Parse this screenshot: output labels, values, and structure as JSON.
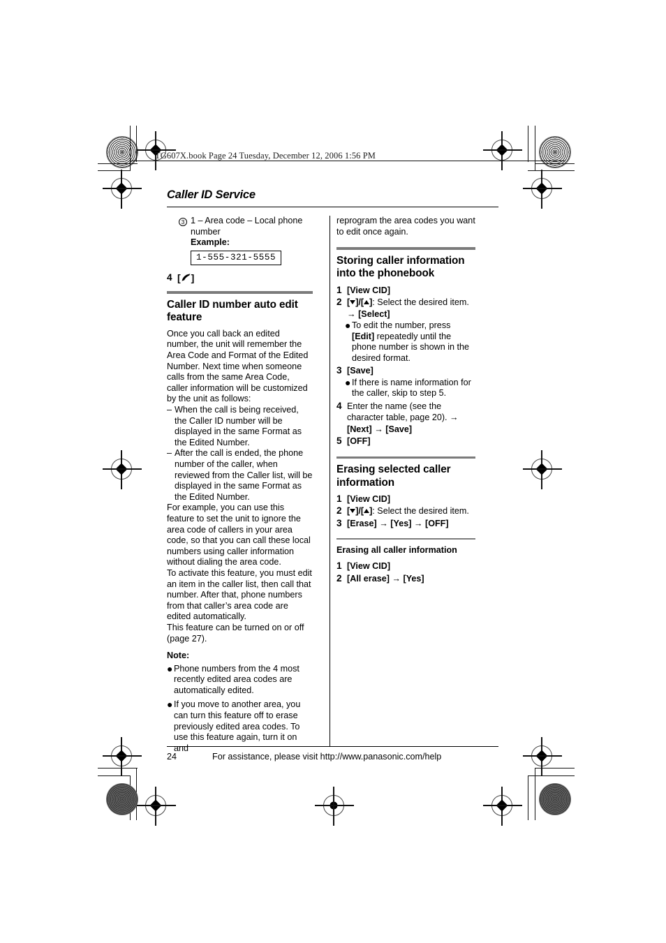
{
  "page_stamp": "TG607X.book  Page 24  Tuesday, December 12, 2006  1:56 PM",
  "running_head": "Caller ID Service",
  "left_column": {
    "circled_item": {
      "marker": "3",
      "text": "1 – Area code – Local phone number"
    },
    "example_label": "Example:",
    "example_value": "1-555-321-5555",
    "step4_number": "4",
    "step4_key_icon": "phone-handset-icon",
    "section1": {
      "heading": "Caller ID number auto edit feature",
      "intro": "Once you call back an edited number, the unit will remember the Area Code and Format of the Edited Number. Next time when someone calls from the same Area Code, caller information will be customized by the unit as follows:",
      "dash_items": [
        "When the call is being received, the Caller ID number will be displayed in the same Format as the Edited Number.",
        "After the call is ended, the phone number of the caller, when reviewed from the Caller list, will be displayed in the same Format as the Edited Number."
      ],
      "para_example": "For example, you can use this feature to set the unit to ignore the area code of callers in your area code, so that you can call these local numbers using caller information without dialing the area code.",
      "para_activate": "To activate this feature, you must edit an item in the caller list, then call that number. After that, phone numbers from that caller’s area code are edited automatically.",
      "para_onoff": "This feature can be turned on or off (page 27).",
      "note_label": "Note:",
      "notes": [
        "Phone numbers from the 4 most recently edited area codes are automatically edited.",
        "If you move to another area, you can turn this feature off to erase previously edited area codes. To use this feature again, turn it on and"
      ]
    }
  },
  "right_column": {
    "continued_text": "reprogram the area codes you want to edit once again.",
    "section_store": {
      "heading": "Storing caller information into the phonebook",
      "steps": [
        {
          "n": "1",
          "parts": [
            {
              "type": "key",
              "text": "[View CID]"
            }
          ]
        },
        {
          "n": "2",
          "parts": [
            {
              "type": "key",
              "text": "[▼]/[▲]"
            },
            {
              "type": "plain",
              "text": ": Select the desired item. "
            },
            {
              "type": "arrow",
              "text": "→"
            },
            {
              "type": "key",
              "text": " [Select]"
            }
          ],
          "bullets": [
            "To edit the number, press [Edit] repeatedly until the phone number is shown in the desired format."
          ]
        },
        {
          "n": "3",
          "parts": [
            {
              "type": "key",
              "text": "[Save]"
            }
          ],
          "bullets": [
            "If there is name information for the caller, skip to step 5."
          ]
        },
        {
          "n": "4",
          "parts": [
            {
              "type": "plain",
              "text": "Enter the name (see the character table, page 20). "
            },
            {
              "type": "arrow",
              "text": "→"
            },
            {
              "type": "key",
              "text": " [Next] "
            },
            {
              "type": "arrow",
              "text": "→"
            },
            {
              "type": "key",
              "text": " [Save]"
            }
          ]
        },
        {
          "n": "5",
          "parts": [
            {
              "type": "key",
              "text": "[OFF]"
            }
          ]
        }
      ],
      "bullet_edit_pre": "To edit the number, press ",
      "bullet_edit_key": "[Edit]",
      "bullet_edit_post": " repeatedly until the phone number is shown in the desired format.",
      "bullet_skip": "If there is name information for the caller, skip to step 5.",
      "step4_pre": "Enter the name (see the character table, page 20). "
    },
    "section_erase_selected": {
      "heading": "Erasing selected caller information",
      "step1_key": "[View CID]",
      "step2_keys": "[▼]/[▲]",
      "step2_text": ": Select the desired item.",
      "step3_k1": "[Erase]",
      "step3_k2": "[Yes]",
      "step3_k3": "[OFF]"
    },
    "section_erase_all": {
      "heading": "Erasing all caller information",
      "step1_key": "[View CID]",
      "step2_k1": "[All erase]",
      "step2_k2": "[Yes]"
    }
  },
  "footer": {
    "page_number": "24",
    "assistance": "For assistance, please visit http://www.panasonic.com/help"
  },
  "step_numbers": {
    "one": "1",
    "two": "2",
    "three": "3",
    "four": "4",
    "five": "5"
  },
  "glyphs": {
    "arrow": "→",
    "bullet": "●",
    "dash": "–"
  }
}
